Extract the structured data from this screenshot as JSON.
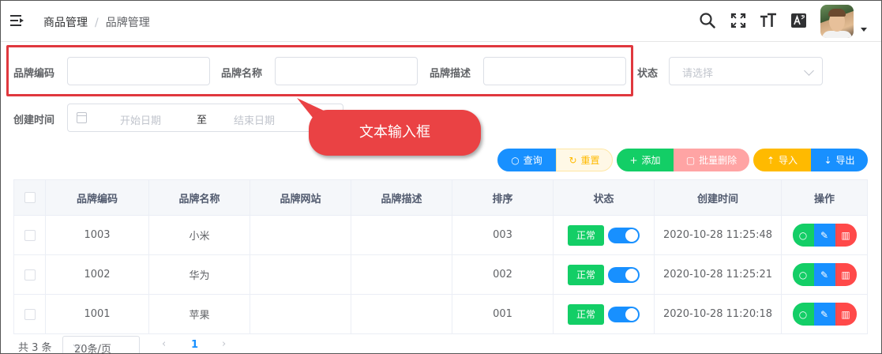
{
  "header": {
    "breadcrumb": [
      "商品管理",
      "品牌管理"
    ],
    "breadcrumb_separator": "/",
    "icons": [
      "menu-fold-icon",
      "search-icon",
      "fullscreen-icon",
      "font-size-icon",
      "language-icon"
    ]
  },
  "search_form": {
    "brand_code_label": "品牌编码",
    "brand_code_value": "",
    "brand_name_label": "品牌名称",
    "brand_name_value": "",
    "brand_desc_label": "品牌描述",
    "brand_desc_value": "",
    "status_label": "状态",
    "status_placeholder": "请选择",
    "create_time_label": "创建时间",
    "start_date_placeholder": "开始日期",
    "range_separator": "至",
    "end_date_placeholder": "结束日期"
  },
  "annotation": {
    "callout_text": "文本输入框",
    "color": "#ea4244"
  },
  "toolbar": {
    "query": "查询",
    "reset": "重置",
    "add": "添加",
    "batch_delete": "批量删除",
    "import": "导入",
    "export": "导出"
  },
  "table": {
    "columns": [
      "品牌编码",
      "品牌名称",
      "品牌网站",
      "品牌描述",
      "排序",
      "状态",
      "创建时间",
      "操作"
    ],
    "rows": [
      {
        "code": "1003",
        "name": "小米",
        "website": "",
        "desc": "",
        "sort": "003",
        "status": "正常",
        "enabled": true,
        "created": "2020-10-28 11:25:48"
      },
      {
        "code": "1002",
        "name": "华为",
        "website": "",
        "desc": "",
        "sort": "002",
        "status": "正常",
        "enabled": true,
        "created": "2020-10-28 11:25:21"
      },
      {
        "code": "1001",
        "name": "苹果",
        "website": "",
        "desc": "",
        "sort": "001",
        "status": "正常",
        "enabled": true,
        "created": "2020-10-28 11:20:18"
      }
    ]
  },
  "pagination": {
    "total": "共 3 条",
    "page_size": "20条/页",
    "current_page": "1"
  },
  "colors": {
    "primary": "#1890ff",
    "success": "#13ce66",
    "danger": "#ff4949",
    "warning": "#ffba00",
    "reset_bg": "#fff8e6",
    "reset_text": "#ffba00",
    "batch_delete_bg": "#ffa4a4"
  }
}
